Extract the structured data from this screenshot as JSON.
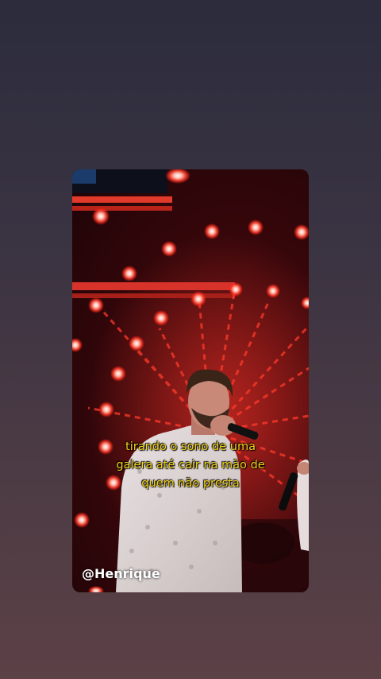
{
  "story": {
    "caption_lines": [
      "tirando o sono de uma",
      "galera até cair na mão de",
      "quem não presta"
    ],
    "watermark": "@Henrique"
  },
  "colors": {
    "background_top": "#2c2c3d",
    "background_bottom": "#5c4146",
    "caption_text": "#f3d21a",
    "stage_light": "#ff4a3a"
  }
}
